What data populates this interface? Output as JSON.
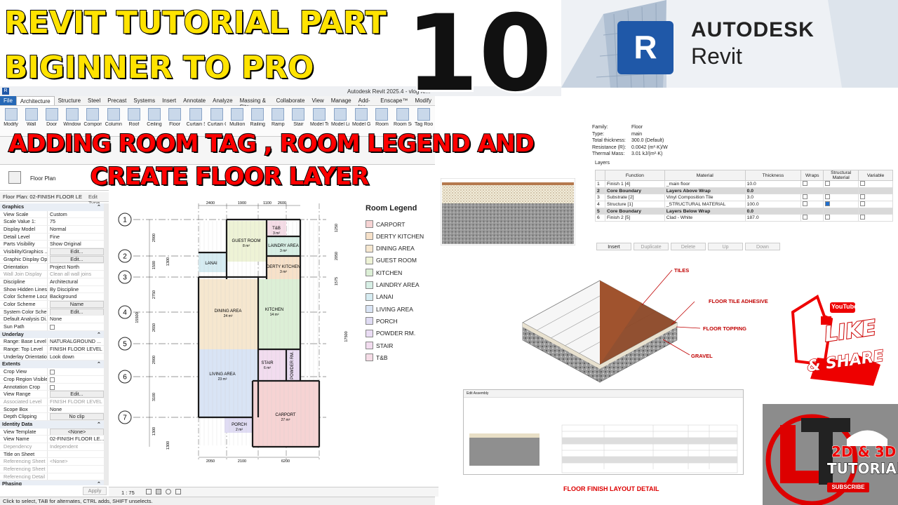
{
  "headline": {
    "line1": "REVIT TUTORIAL PART",
    "line2": "BIGINNER TO PRO",
    "part_number": "10",
    "subtitle_line1": "ADDING ROOM TAG , ROOM LEGEND AND",
    "subtitle_line2": "CREATE FLOOR LAYER"
  },
  "brand": {
    "logo_letter": "R",
    "company": "AUTODESK",
    "product": "Revit"
  },
  "window": {
    "title": "Autodesk Revit 2025.4 - vlog re...",
    "tabs": [
      "File",
      "Architecture",
      "Structure",
      "Steel",
      "Precast",
      "Systems",
      "Insert",
      "Annotate",
      "Analyze",
      "Massing & Site",
      "Collaborate",
      "View",
      "Manage",
      "Add-Ins",
      "Enscape™",
      "Modify"
    ],
    "tools": [
      "Modify",
      "Wall",
      "Door",
      "Window",
      "Component",
      "Column",
      "Roof",
      "Ceiling",
      "Floor",
      "Curtain System",
      "Curtain Grid",
      "Mullion",
      "Railing",
      "Ramp",
      "Stair",
      "Model Text",
      "Model Line",
      "Model Group",
      "Room",
      "Room Separator",
      "Tag Room"
    ]
  },
  "properties": {
    "type_label": "Floor Plan",
    "selector": "Floor Plan: 02-FINISH FLOOR LE",
    "edit_type": "Edit Type",
    "sections": [
      {
        "title": "Graphics",
        "rows": [
          {
            "k": "View Scale",
            "v": "Custom"
          },
          {
            "k": "Scale Value    1:",
            "v": "75"
          },
          {
            "k": "Display Model",
            "v": "Normal"
          },
          {
            "k": "Detail Level",
            "v": "Fine"
          },
          {
            "k": "Parts Visibility",
            "v": "Show Original"
          },
          {
            "k": "Visibility/Graphics ...",
            "v": "Edit...",
            "btn": true
          },
          {
            "k": "Graphic Display Op...",
            "v": "Edit...",
            "btn": true
          },
          {
            "k": "Orientation",
            "v": "Project North"
          },
          {
            "k": "Wall Join Display",
            "v": "Clean all wall joins",
            "grey": true
          },
          {
            "k": "Discipline",
            "v": "Architectural"
          },
          {
            "k": "Show Hidden Lines",
            "v": "By Discipline"
          },
          {
            "k": "Color Scheme Loca...",
            "v": "Background"
          },
          {
            "k": "Color Scheme",
            "v": "Name",
            "btn": true
          },
          {
            "k": "System Color Sche...",
            "v": "Edit...",
            "btn": true
          },
          {
            "k": "Default Analysis Di...",
            "v": "None"
          },
          {
            "k": "Sun Path",
            "v": "",
            "chk": true
          }
        ]
      },
      {
        "title": "Underlay",
        "rows": [
          {
            "k": "Range: Base Level",
            "v": "NATURALGROUND ..."
          },
          {
            "k": "Range: Top Level",
            "v": "FINISH FLOOR LEVEL"
          },
          {
            "k": "Underlay Orientation",
            "v": "Look down"
          }
        ]
      },
      {
        "title": "Extents",
        "rows": [
          {
            "k": "Crop View",
            "v": "",
            "chk": true
          },
          {
            "k": "Crop Region Visible",
            "v": "",
            "chk": true
          },
          {
            "k": "Annotation Crop",
            "v": "",
            "chk": true
          },
          {
            "k": "View Range",
            "v": "Edit...",
            "btn": true
          },
          {
            "k": "Associated Level",
            "v": "FINISH FLOOR LEVEL",
            "grey": true
          },
          {
            "k": "Scope Box",
            "v": "None"
          },
          {
            "k": "Depth Clipping",
            "v": "No clip",
            "btn": true
          }
        ]
      },
      {
        "title": "Identity Data",
        "rows": [
          {
            "k": "View Template",
            "v": "<None>",
            "btn": true
          },
          {
            "k": "View Name",
            "v": "02-FINISH FLOOR LE..."
          },
          {
            "k": "Dependency",
            "v": "Independent",
            "grey": true
          },
          {
            "k": "Title on Sheet",
            "v": ""
          },
          {
            "k": "Referencing Sheet ...",
            "v": "<None>",
            "grey": true
          },
          {
            "k": "Referencing Sheet",
            "v": "",
            "grey": true
          },
          {
            "k": "Referencing Detail",
            "v": "",
            "grey": true
          }
        ]
      },
      {
        "title": "Phasing",
        "rows": []
      }
    ],
    "apply": "Apply"
  },
  "viewbar": {
    "scale": "1 : 75"
  },
  "status": "Click to select, TAB for alternates, CTRL adds, SHIFT unselects.",
  "plan": {
    "grids": [
      "1",
      "2",
      "3",
      "4",
      "5",
      "6",
      "7"
    ],
    "top_dims": [
      "2400",
      "1900",
      "1100",
      "2600"
    ],
    "bottom_dims": [
      "2050",
      "2100",
      "6200"
    ],
    "left_dims": [
      "2900",
      "1500",
      "1300",
      "2750",
      "2650",
      "2900",
      "3100",
      "1300",
      "1300"
    ],
    "right_dims": [
      "1250",
      "2050",
      "1575"
    ],
    "overall_dims": [
      "15500",
      "17500"
    ],
    "rooms": [
      {
        "name": "GUEST ROOM",
        "area": "8 m²"
      },
      {
        "name": "T&B",
        "area": "3 m²"
      },
      {
        "name": "LAINDRY AREA",
        "area": "3 m²"
      },
      {
        "name": "LANAI",
        "area": ""
      },
      {
        "name": "DERTY KITCHEN",
        "area": "3 m²"
      },
      {
        "name": "DINING AREA",
        "area": "24 m²"
      },
      {
        "name": "KITCHEN",
        "area": "14 m²"
      },
      {
        "name": "STAIR",
        "area": "6 m²"
      },
      {
        "name": "POWDER RM.",
        "area": ""
      },
      {
        "name": "LIVING AREA",
        "area": "23 m²"
      },
      {
        "name": "CARPORT",
        "area": "27 m²"
      },
      {
        "name": "PORCH",
        "area": "2 m²"
      }
    ]
  },
  "legend": {
    "title": "Room Legend",
    "items": [
      {
        "label": "CARPORT",
        "color": "#f6d3d3"
      },
      {
        "label": "DERTY KITCHEN",
        "color": "#f7e1c9"
      },
      {
        "label": "DINING AREA",
        "color": "#f6e7cf"
      },
      {
        "label": "GUEST ROOM",
        "color": "#eef3d6"
      },
      {
        "label": "KITCHEN",
        "color": "#dcefd6"
      },
      {
        "label": "LAINDRY AREA",
        "color": "#d7efe5"
      },
      {
        "label": "LANAI",
        "color": "#d6ecf2"
      },
      {
        "label": "LIVING AREA",
        "color": "#d9e4f5"
      },
      {
        "label": "PORCH",
        "color": "#e0dcf4"
      },
      {
        "label": "POWDER RM.",
        "color": "#eadcf4"
      },
      {
        "label": "STAIR",
        "color": "#f2dcef"
      },
      {
        "label": "T&B",
        "color": "#f5dce6"
      }
    ]
  },
  "assembly": {
    "info": [
      {
        "k": "Family:",
        "v": "Floor"
      },
      {
        "k": "Type:",
        "v": "main"
      },
      {
        "k": "Total thickness:",
        "v": "300.0 (Default)"
      },
      {
        "k": "Resistance (R):",
        "v": "0.0042 (m²·K)/W"
      },
      {
        "k": "Thermal Mass:",
        "v": "3.01 kJ/(m²·K)"
      }
    ],
    "layers_label": "Layers",
    "columns": [
      "",
      "Function",
      "Material",
      "Thickness",
      "Wraps",
      "Structural Material",
      "Variable"
    ],
    "rows": [
      {
        "n": "1",
        "f": "Finish 1 [4]",
        "m": "_main floor",
        "t": "10.0",
        "core": false,
        "struct": false
      },
      {
        "n": "2",
        "f": "Core Boundary",
        "m": "Layers Above Wrap",
        "t": "0.0",
        "core": true,
        "struct": false
      },
      {
        "n": "3",
        "f": "Substrate [2]",
        "m": "Vinyl Composition Tile",
        "t": "3.0",
        "core": false,
        "struct": false
      },
      {
        "n": "4",
        "f": "Structure [1]",
        "m": "_STRUCTURAL MATERIAL",
        "t": "100.0",
        "core": false,
        "struct": true
      },
      {
        "n": "5",
        "f": "Core Boundary",
        "m": "Layers Below Wrap",
        "t": "0.0",
        "core": true,
        "struct": false
      },
      {
        "n": "6",
        "f": "Finish 2 [5]",
        "m": "Clad - White",
        "t": "187.0",
        "core": false,
        "struct": false
      }
    ],
    "buttons": [
      "Insert",
      "Duplicate",
      "Delete",
      "Up",
      "Down"
    ]
  },
  "detail": {
    "callouts": [
      "TILES",
      "FLOOR TILE ADHESIVE",
      "FLOOR TOPPING",
      "GRAVEL"
    ],
    "caption": "FLOOR FINISH LAYOUT DETAIL",
    "mini_title": "Edit Assembly"
  },
  "social": {
    "youtube": "YouTube",
    "like": "LIKE",
    "share": "& SHARE",
    "channel_line1": "2D & 3D",
    "channel_line2": "TUTORIAL",
    "subscribe": "SUBSCRIBE"
  }
}
